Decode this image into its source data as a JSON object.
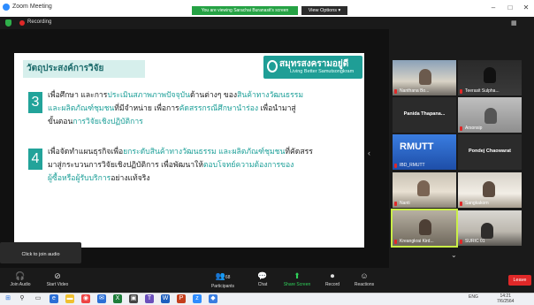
{
  "titlebar": {
    "app_title": "Zoom Meeting",
    "share_banner": "You are viewing Sarachai Buranasit's screen",
    "view_options": "View Options ▾"
  },
  "status": {
    "recording": "Recording"
  },
  "slide": {
    "heading": "วัตถุประสงค์การวิจัย",
    "logo_name": "สมุทรสงครามอยู่ดี",
    "logo_tagline": "Living Better Samutsongkram",
    "point3": {
      "num": "3",
      "line1_a": "เพื่อศึกษา และการ",
      "line1_b": "ประเมินสภาพภาพปัจจุบัน",
      "line1_c": "ด้านต่างๆ ของ",
      "line1_d": "สินค้าทางวัฒนธรรม",
      "line2_a": "และผลิตภัณฑ์ชุมชน",
      "line2_b": "ที่มีจำหน่าย เพื่อการ",
      "line2_c": "คัดสรรกรณีศึกษานำร่อง",
      "line2_d": " เพื่อนำมาสู่",
      "line3_a": "ขั้นตอน",
      "line3_b": "การวิจัยเชิงปฏิบัติการ"
    },
    "point4": {
      "num": "4",
      "line1_a": "เพื่อจัดทำแผนธุรกิจเพื่อ",
      "line1_b": "ยกระดับสินค้าทางวัฒนธรรม และผลิตภัณฑ์ชุมชน",
      "line1_c": "ที่คัดสรร",
      "line2_a": "มาสู่กระบวนการวิจัยเชิงปฏิบัติการ เพื่อพัฒนาให้",
      "line2_b": "ตอบโจทย์ความต้องการของ",
      "line3_a": "ผู้ซื้อหรือผู้รับบริการ",
      "line3_b": "อย่างแท้จริง"
    },
    "hint": "Click to join audio"
  },
  "gallery": [
    {
      "name": "Nanthana Bo...",
      "muted": true
    },
    {
      "name": "Teerasit Sulpha...",
      "muted": true
    },
    {
      "name": "Panida  Thapana...",
      "muted": false
    },
    {
      "name": "Arsonsip",
      "muted": true
    },
    {
      "name": "IBD_RMUTT",
      "muted": true
    },
    {
      "name": "Pondej Chaowarat",
      "muted": false
    },
    {
      "name": "Nanti",
      "muted": true
    },
    {
      "name": "Sangkakorn",
      "muted": true
    },
    {
      "name": "Kreangkrai Kird...",
      "muted": true
    },
    {
      "name": "SURIC 01",
      "muted": true
    }
  ],
  "tile_extra": {
    "rmutt_text": "RMUTT"
  },
  "toolbar": {
    "join_audio": "Join Audio",
    "start_video": "Start Video",
    "participants": "Participants",
    "participants_count": "68",
    "chat": "Chat",
    "share_screen": "Share Screen",
    "record": "Record",
    "reactions": "Reactions",
    "leave": "Leave"
  },
  "taskbar": {
    "lang": "ENG",
    "time": "14:21",
    "date": "7/6/2564"
  },
  "colors": {
    "accent": "#1ea099",
    "leave": "#e02828",
    "share_green": "#25a244"
  }
}
